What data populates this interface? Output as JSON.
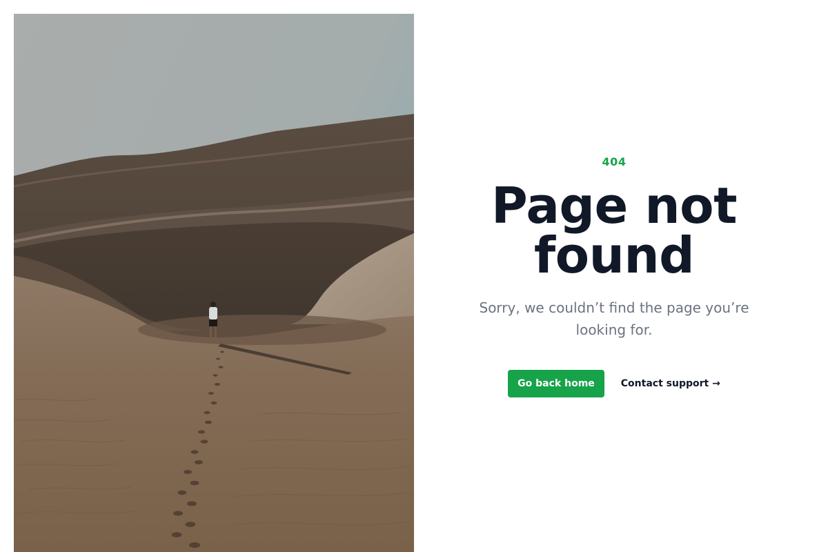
{
  "error": {
    "code": "404",
    "title": "Page not found",
    "message": "Sorry, we couldn’t find the page you’re looking for."
  },
  "actions": {
    "home_label": "Go back home",
    "support_label": "Contact support",
    "support_arrow": "→"
  },
  "colors": {
    "accent": "#16a34a",
    "title": "#111827",
    "subtitle": "#6b7280"
  },
  "image": {
    "subject": "desert dunes with a hiker and footprints"
  }
}
